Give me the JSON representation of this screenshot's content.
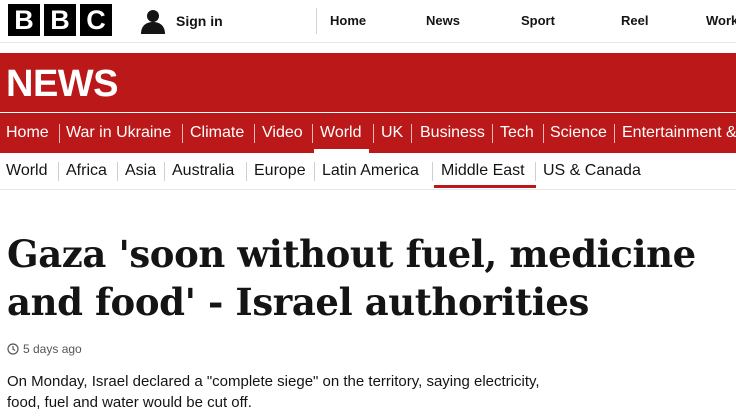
{
  "brand": {
    "letters": [
      "B",
      "B",
      "C"
    ],
    "section_title": "NEWS"
  },
  "account": {
    "signin_label": "Sign in",
    "icon": "user-icon"
  },
  "top_nav": [
    "Home",
    "News",
    "Sport",
    "Reel",
    "Worklife"
  ],
  "red_nav": {
    "items": [
      "Home",
      "War in Ukraine",
      "Climate",
      "Video",
      "World",
      "UK",
      "Business",
      "Tech",
      "Science",
      "Entertainment & Arts"
    ],
    "active": "World"
  },
  "sub_nav": {
    "items": [
      "World",
      "Africa",
      "Asia",
      "Australia",
      "Europe",
      "Latin America",
      "Middle East",
      "US & Canada"
    ],
    "active": "Middle East"
  },
  "article": {
    "headline": "Gaza 'soon without fuel, medicine and food' - Israel authorities",
    "timestamp": "5 days ago",
    "summary": "On Monday, Israel declared a \"complete siege\" on the territory, saying electricity, food, fuel and water would be cut off."
  },
  "colors": {
    "brand_red": "#bb1919",
    "text": "#141414",
    "muted": "#545658"
  }
}
